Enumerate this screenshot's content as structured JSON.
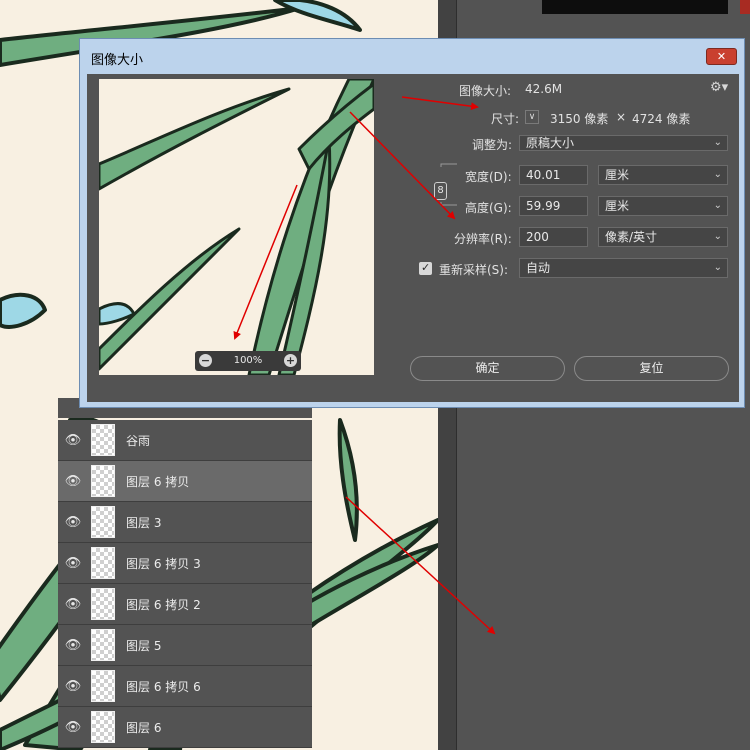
{
  "dialog": {
    "title": "图像大小",
    "close_icon": "close-icon",
    "image_size_label": "图像大小:",
    "image_size_value": "42.6M",
    "settings_icon": "gear-icon",
    "dimensions_label": "尺寸:",
    "dimensions_width": "3150 像素",
    "dimensions_times": "×",
    "dimensions_height": "4724 像素",
    "fit_to_label": "调整为:",
    "fit_to_value": "原稿大小",
    "width_label": "宽度(D):",
    "width_value": "40.01",
    "width_unit": "厘米",
    "height_label": "高度(G):",
    "height_value": "59.99",
    "height_unit": "厘米",
    "resolution_label": "分辨率(R):",
    "resolution_value": "200",
    "resolution_unit": "像素/英寸",
    "resample_label": "重新采样(S):",
    "resample_checked": true,
    "resample_value": "自动",
    "ok_label": "确定",
    "reset_label": "复位",
    "zoom_value": "100%"
  },
  "layers": [
    {
      "name": "谷雨",
      "selected": false
    },
    {
      "name": "图层 6 拷贝",
      "selected": true
    },
    {
      "name": "图层 3",
      "selected": false
    },
    {
      "name": "图层 6 拷贝 3",
      "selected": false
    },
    {
      "name": "图层 6 拷贝 2",
      "selected": false
    },
    {
      "name": "图层 5",
      "selected": false
    },
    {
      "name": "图层 6 拷贝 6",
      "selected": false
    },
    {
      "name": "图层 6",
      "selected": false
    }
  ],
  "colors": {
    "dialog_bg": "#535353",
    "title_bar": "#bcd3ec",
    "close_button": "#c9402f",
    "arrow": "#e00000",
    "canvas_bg": "#f8f0e2",
    "leaf": "#6fae80"
  }
}
